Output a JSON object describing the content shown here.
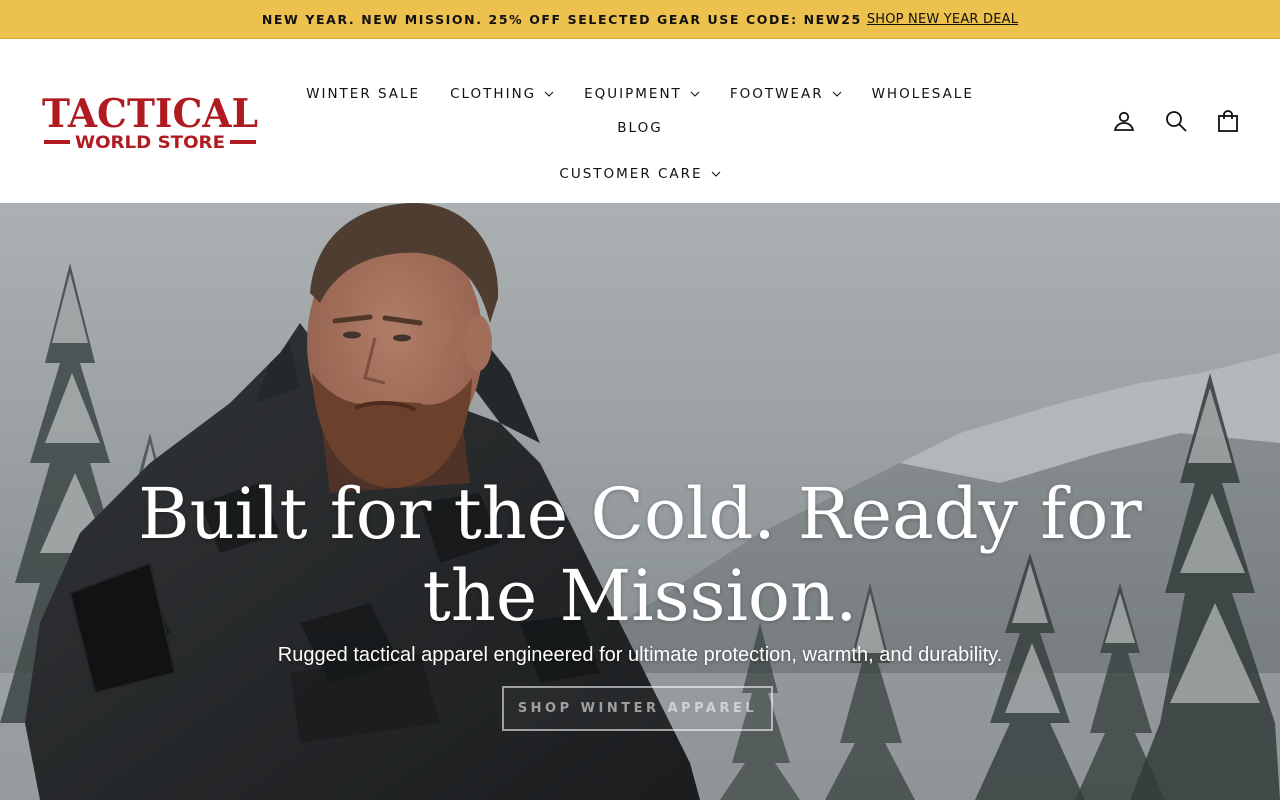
{
  "announcement": {
    "message": "NEW YEAR. NEW MISSION. 25% OFF SELECTED GEAR USE CODE: NEW25",
    "link_label": "SHOP NEW YEAR DEAL"
  },
  "logo": {
    "line1": "TACTICAL",
    "line2": "WORLD STORE",
    "brand_color": "#b01b22"
  },
  "nav": {
    "items": [
      {
        "label": "WINTER SALE",
        "dropdown": false
      },
      {
        "label": "CLOTHING",
        "dropdown": true
      },
      {
        "label": "EQUIPMENT",
        "dropdown": true
      },
      {
        "label": "FOOTWEAR",
        "dropdown": true
      },
      {
        "label": "WHOLESALE",
        "dropdown": false
      },
      {
        "label": "BLOG",
        "dropdown": false
      },
      {
        "label": "CUSTOMER CARE",
        "dropdown": true
      }
    ]
  },
  "header_icons": [
    "account-icon",
    "search-icon",
    "cart-icon"
  ],
  "hero": {
    "title": "Built for the Cold. Ready for the Mission.",
    "subtitle": "Rugged tactical apparel engineered for ultimate protection, warmth, and durability.",
    "button_label": "SHOP WINTER APPAREL"
  },
  "colors": {
    "announcement_bg": "#edc14e",
    "text": "#111111"
  }
}
